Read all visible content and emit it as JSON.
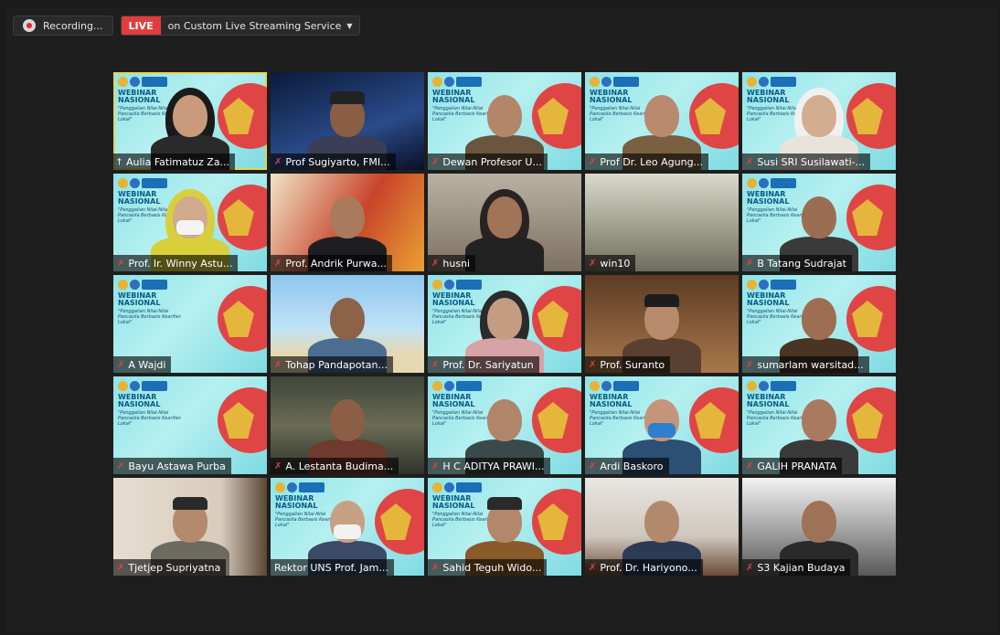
{
  "toolbar": {
    "recording_label": "Recording...",
    "live_badge": "LIVE",
    "live_service": "on Custom Live Streaming Service",
    "dropdown_icon": "chevron-down-icon"
  },
  "slide": {
    "title_line1": "WEBINAR",
    "title_line2": "NASIONAL",
    "subtitle": "\"Penggalian Nilai-Nilai Pancasila Berbasis Kearifan Lokal\""
  },
  "participants": [
    {
      "name": "Aulia Fatimatuz Za...",
      "mic": "pin"
    },
    {
      "name": "Prof Sugiyarto, FMI...",
      "mic": "muted"
    },
    {
      "name": "Dewan Profesor U...",
      "mic": "muted"
    },
    {
      "name": "Prof Dr. Leo Agung...",
      "mic": "muted"
    },
    {
      "name": "Susi SRI Susilawati-...",
      "mic": "muted"
    },
    {
      "name": "Prof. Ir. Winny Astu...",
      "mic": "muted"
    },
    {
      "name": "Prof. Andrik Purwa...",
      "mic": "muted"
    },
    {
      "name": "husni",
      "mic": "muted"
    },
    {
      "name": "win10",
      "mic": "muted"
    },
    {
      "name": "B Tatang Sudrajat",
      "mic": "muted"
    },
    {
      "name": "A Wajdi",
      "mic": "muted"
    },
    {
      "name": "Tohap Pandapotan...",
      "mic": "muted"
    },
    {
      "name": "Prof. Dr. Sariyatun",
      "mic": "muted"
    },
    {
      "name": "Prof. Suranto",
      "mic": "muted"
    },
    {
      "name": "sumarlam warsitad...",
      "mic": "muted"
    },
    {
      "name": "Bayu Astawa Purba",
      "mic": "muted"
    },
    {
      "name": "A. Lestanta Budima...",
      "mic": "muted"
    },
    {
      "name": "H C ADITYA PRAWI...",
      "mic": "muted"
    },
    {
      "name": "Ardi Baskoro",
      "mic": "muted"
    },
    {
      "name": "GALIH PRANATA",
      "mic": "muted"
    },
    {
      "name": "Tjetjep Supriyatna",
      "mic": "muted"
    },
    {
      "name": "Rektor UNS Prof. Jam...",
      "mic": "none"
    },
    {
      "name": "Sahid Teguh Wido...",
      "mic": "muted"
    },
    {
      "name": "Prof. Dr. Hariyono...",
      "mic": "muted"
    },
    {
      "name": "S3 Kajian Budaya",
      "mic": "muted"
    }
  ],
  "colors": {
    "live": "#e23d3d",
    "active_border": "#e5d64a",
    "muted_icon": "#e04040"
  }
}
